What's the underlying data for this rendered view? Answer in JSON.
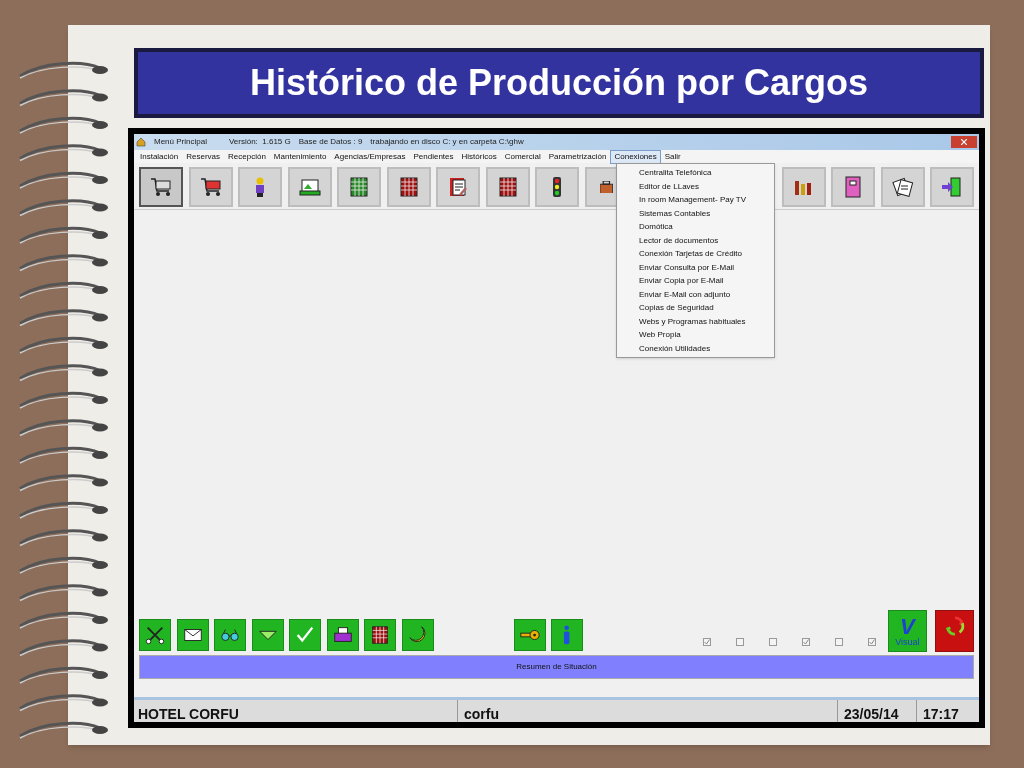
{
  "slide": {
    "title": "Histórico de Producción por Cargos"
  },
  "window": {
    "title": "Menú Principal",
    "version": "Versión:  1.615 G",
    "database": "Base de Datos : 9",
    "location": "trabajando en disco C: y en carpeta C:\\ghw"
  },
  "menu_bar": [
    {
      "label": "Instalación",
      "selected": false
    },
    {
      "label": "Reservas",
      "selected": false
    },
    {
      "label": "Recepción",
      "selected": false
    },
    {
      "label": "Mantenimiento",
      "selected": false
    },
    {
      "label": "Agencias/Empresas",
      "selected": false
    },
    {
      "label": "Pendientes",
      "selected": false
    },
    {
      "label": "Históricos",
      "selected": false
    },
    {
      "label": "Comercial",
      "selected": false
    },
    {
      "label": "Parametrización",
      "selected": false
    },
    {
      "label": "Conexiones",
      "selected": true
    },
    {
      "label": "Salir",
      "selected": false
    }
  ],
  "toolbar_left": [
    {
      "kind": "cart",
      "selected": true
    },
    {
      "kind": "cart_red",
      "selected": false
    },
    {
      "kind": "person",
      "selected": false
    },
    {
      "kind": "tray",
      "selected": false
    },
    {
      "kind": "grid",
      "selected": false
    },
    {
      "kind": "grid_red",
      "selected": false
    },
    {
      "kind": "book",
      "selected": false
    },
    {
      "kind": "grid_red",
      "selected": false
    },
    {
      "kind": "traffic_light",
      "selected": false
    },
    {
      "kind": "case",
      "selected": false
    }
  ],
  "toolbar_right": [
    {
      "kind": "bars",
      "selected": false
    },
    {
      "kind": "notebook",
      "selected": false
    },
    {
      "kind": "notes",
      "selected": false
    },
    {
      "kind": "exit",
      "selected": false
    }
  ],
  "dropdown": [
    "Centralita Telefónica",
    "Editor de LLaves",
    "In room Management- Pay TV",
    "Sistemas Contables",
    "Domótica",
    "Lector de documentos",
    "Conexión Tarjetas de Crédito",
    "Enviar Consulta por E-Mail",
    "Enviar Copia por E-Mail",
    "Enviar E-Mail con adjunto",
    "Copias de Seguridad",
    "Webs y Programas habituales",
    "Web Propia",
    "Conexión Utilidades"
  ],
  "bottom_left": [
    {
      "kind": "scissors"
    },
    {
      "kind": "mail"
    },
    {
      "kind": "glasses"
    },
    {
      "kind": "triangle"
    },
    {
      "kind": "check"
    },
    {
      "kind": "printer"
    },
    {
      "kind": "grid_red"
    },
    {
      "kind": "moon"
    }
  ],
  "bottom_middle": [
    {
      "kind": "key"
    },
    {
      "kind": "info"
    }
  ],
  "checkboxes": [
    {
      "checked": true
    },
    {
      "checked": false
    },
    {
      "checked": false
    },
    {
      "checked": true
    },
    {
      "checked": false
    },
    {
      "checked": true
    }
  ],
  "visual_button": {
    "letter": "V",
    "label": "Visual"
  },
  "summary_bar": "Resumen de Situación",
  "status_bar": {
    "hotel": "HOTEL CORFU",
    "user": "corfu",
    "date": "23/05/14",
    "time": "17:17"
  }
}
